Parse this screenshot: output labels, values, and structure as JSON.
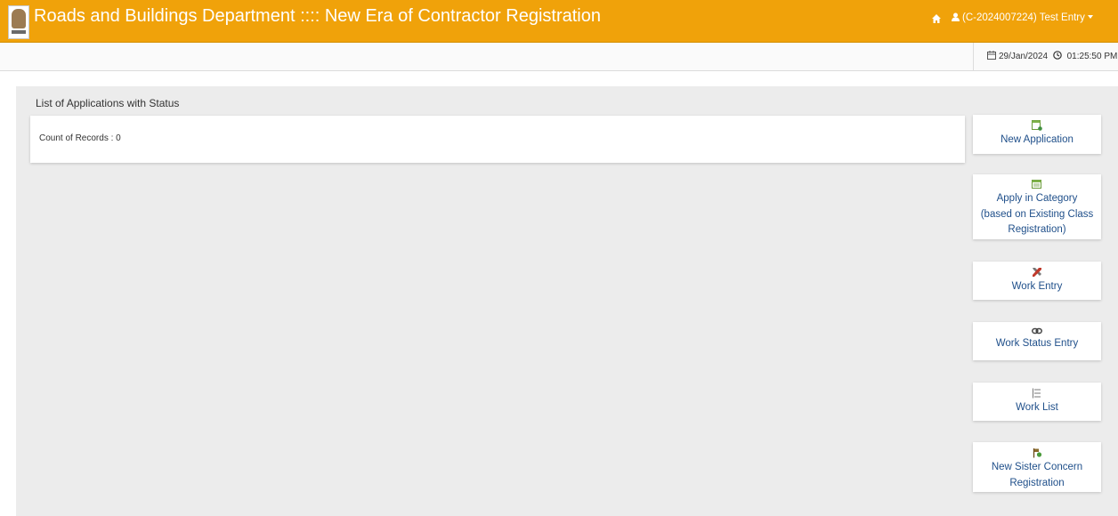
{
  "header": {
    "app_title": "Roads and Buildings Department :::: New Era of Contractor Registration",
    "user_label": "(C-2024007224) Test Entry"
  },
  "subbar": {
    "date": "29/Jan/2024",
    "time": "01:25:50 PM"
  },
  "panel": {
    "title": "List of Applications with Status",
    "records_text": "Count of Records : 0"
  },
  "actions": [
    {
      "line1": "New Application",
      "icon": "new-document-icon"
    },
    {
      "line1": "Apply in Category",
      "line2": "(based on Existing Class",
      "line3": "Registration)",
      "icon": "category-icon"
    },
    {
      "line1": "Work Entry",
      "icon": "hammer-wrench-icon"
    },
    {
      "line1": "Work Status Entry",
      "icon": "chain-link-icon"
    },
    {
      "line1": "Work List",
      "icon": "list-tree-icon"
    },
    {
      "line1": "New Sister Concern",
      "line2": "Registration",
      "icon": "add-flag-icon"
    }
  ],
  "colors": {
    "header_bg": "#f0a20a",
    "link": "#1f4f8a",
    "panel_bg": "#ececec"
  }
}
